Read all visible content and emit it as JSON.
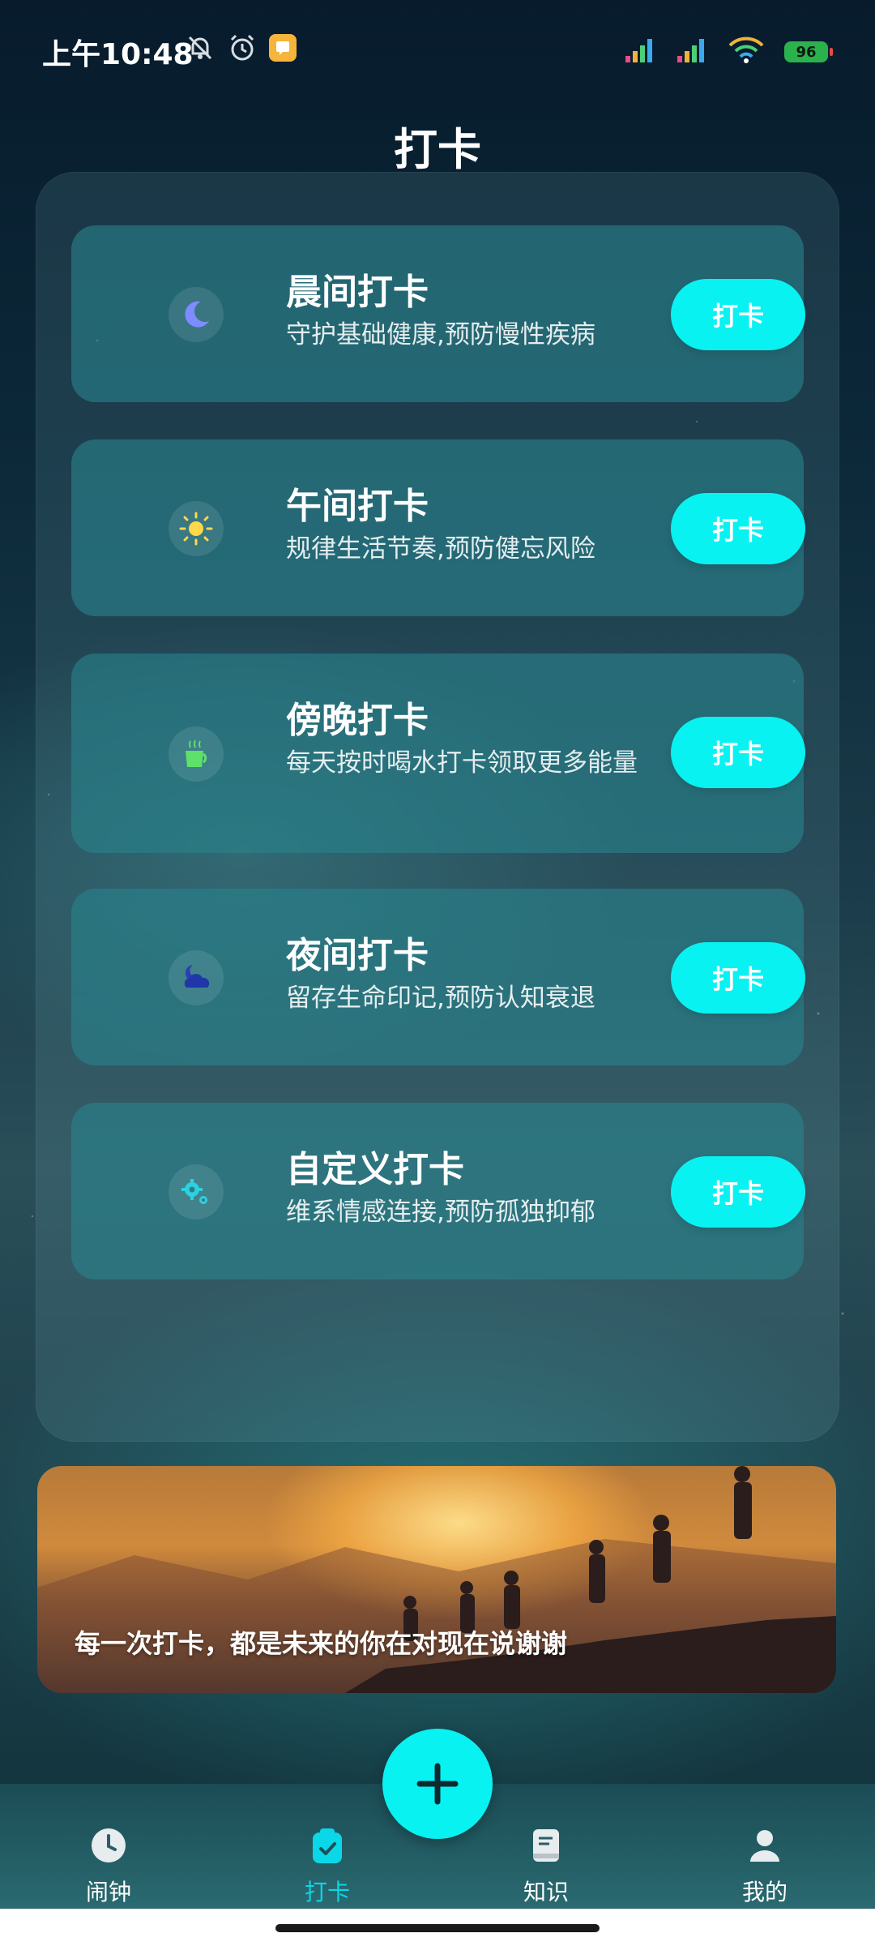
{
  "status_bar": {
    "time": "上午10:48",
    "battery": "96"
  },
  "page": {
    "title": "打卡"
  },
  "checkin_cards": [
    {
      "title": "晨间打卡",
      "desc": "守护基础健康,预防慢性疾病",
      "button": "打卡",
      "icon": "moon-icon"
    },
    {
      "title": "午间打卡",
      "desc": "规律生活节奏,预防健忘风险",
      "button": "打卡",
      "icon": "sun-icon"
    },
    {
      "title": "傍晚打卡",
      "desc": "每天按时喝水打卡领取更多能量",
      "button": "打卡",
      "icon": "cup-icon"
    },
    {
      "title": "夜间打卡",
      "desc": "留存生命印记,预防认知衰退",
      "button": "打卡",
      "icon": "moon-cloud-icon"
    },
    {
      "title": "自定义打卡",
      "desc": "维系情感连接,预防孤独抑郁",
      "button": "打卡",
      "icon": "gears-icon"
    }
  ],
  "banner": {
    "text": "每一次打卡，都是未来的你在对现在说谢谢"
  },
  "bottom_nav": {
    "items": [
      {
        "label": "闹钟",
        "icon": "clock-icon",
        "active": false
      },
      {
        "label": "打卡",
        "icon": "clipboard-check-icon",
        "active": true
      },
      {
        "label": "知识",
        "icon": "book-icon",
        "active": false
      },
      {
        "label": "我的",
        "icon": "user-icon",
        "active": false
      }
    ]
  },
  "colors": {
    "accent": "#08f2f2",
    "active_nav": "#0ad7e8",
    "card_bg": "#2a7f88"
  }
}
